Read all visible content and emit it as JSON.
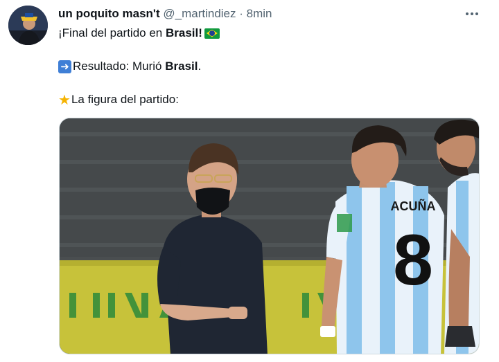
{
  "author": {
    "display_name": "un poquito masn't",
    "handle": "@_martindiez",
    "separator": "·",
    "time": "8min"
  },
  "icons": {
    "more": "more-horizontal-icon",
    "flag": "brazil-flag-icon",
    "arrow": "right-arrow-icon",
    "star": "star-icon"
  },
  "tweet": {
    "line1_prefix": "¡Final del partido en ",
    "line1_bold": "Brasil!",
    "line2_prefix": "Resultado: Murió ",
    "line2_bold": "Brasil",
    "line2_suffix": ".",
    "line3": "La figura del partido:"
  },
  "media": {
    "jersey_name": "ACUÑA",
    "jersey_number": "8"
  },
  "colors": {
    "text": "#0f1419",
    "secondary": "#536471",
    "flag_green": "#109a3f",
    "flag_yellow": "#f6d915",
    "flag_blue": "#1f3f93",
    "jersey_blue": "#8ec5ec"
  }
}
